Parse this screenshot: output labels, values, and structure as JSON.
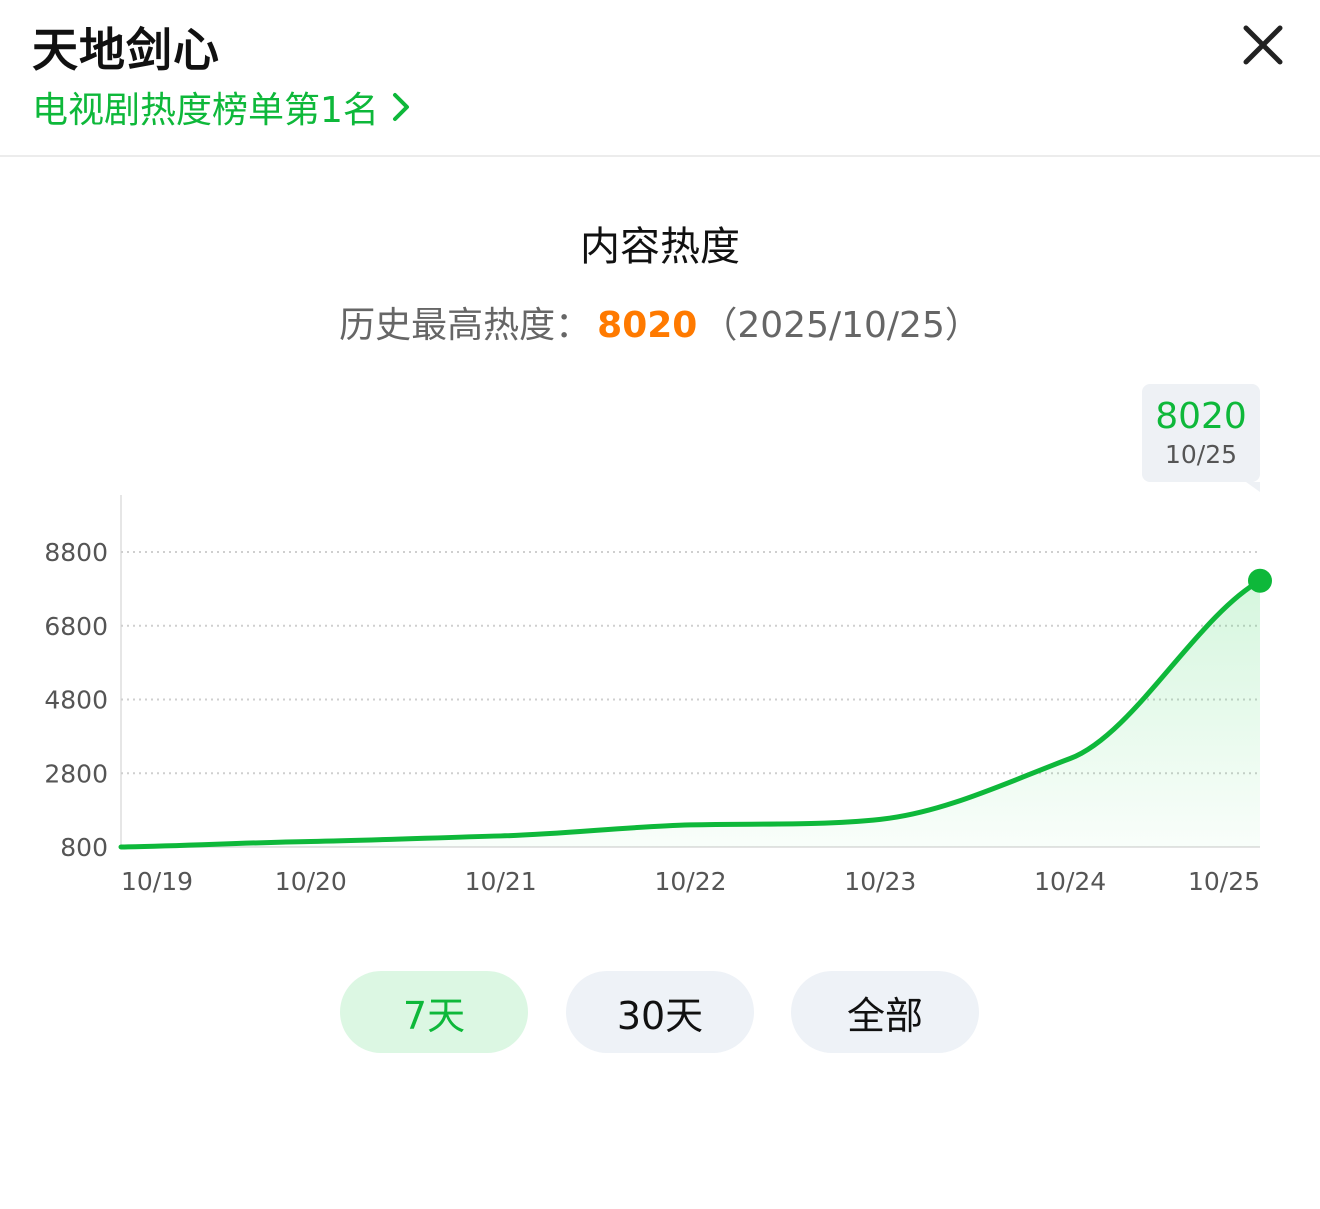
{
  "header": {
    "title": "天地剑心",
    "rank_text": "电视剧热度榜单第1名",
    "close_icon": "close-icon",
    "chevron_icon": "chevron-right-icon"
  },
  "summary": {
    "heading": "内容热度",
    "peak_label": "历史最高热度：",
    "peak_value": "8020",
    "peak_date": "（2025/10/25）"
  },
  "tooltip": {
    "value": "8020",
    "date": "10/25"
  },
  "range_tabs": [
    {
      "label": "7天",
      "active": true
    },
    {
      "label": "30天",
      "active": false
    },
    {
      "label": "全部",
      "active": false
    }
  ],
  "colors": {
    "accent_green": "#0eb83a",
    "peak_orange": "#ff7a00",
    "active_tab_bg": "#dcf7e3",
    "tab_bg": "#eef2f7"
  },
  "chart_data": {
    "type": "area",
    "categories": [
      "10/19",
      "10/20",
      "10/21",
      "10/22",
      "10/23",
      "10/24",
      "10/25"
    ],
    "series": [
      {
        "values": [
          800,
          950,
          1100,
          1400,
          1550,
          3200,
          8020
        ]
      }
    ],
    "y_ticks": [
      800,
      2800,
      4800,
      6800,
      8800
    ],
    "ylim": [
      800,
      8800
    ],
    "grid": true,
    "highlight_index": 6
  }
}
